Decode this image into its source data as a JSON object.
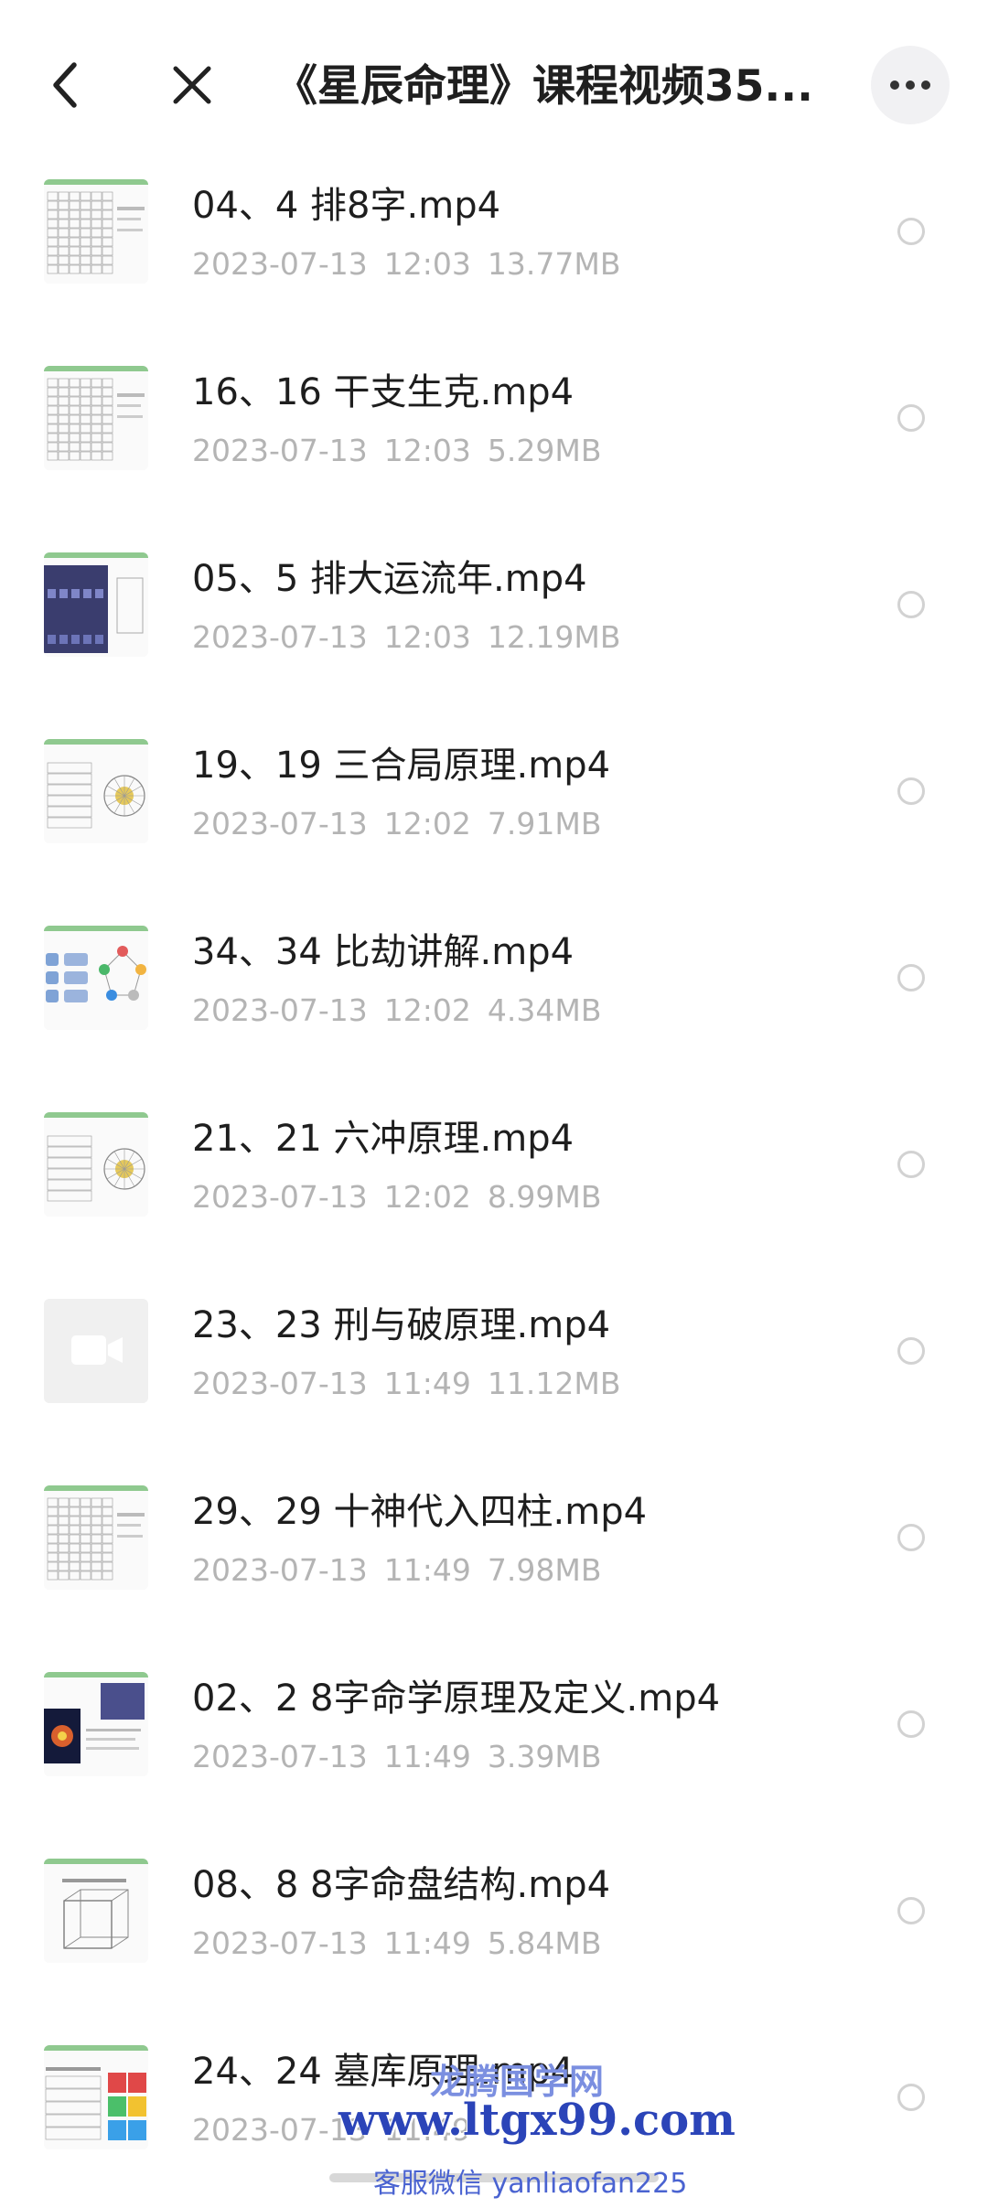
{
  "header": {
    "title": "《星辰命理》课程视频35...",
    "back_icon": "chevron-left-icon",
    "close_icon": "close-icon",
    "more_icon": "more-horizontal-icon"
  },
  "files": [
    {
      "name": "04、4 排8字.mp4",
      "date": "2023-07-13",
      "time": "12:03",
      "size": "13.77MB",
      "thumb": "table"
    },
    {
      "name": "16、16 干支生克.mp4",
      "date": "2023-07-13",
      "time": "12:03",
      "size": "5.29MB",
      "thumb": "table"
    },
    {
      "name": "05、5 排大运流年.mp4",
      "date": "2023-07-13",
      "time": "12:03",
      "size": "12.19MB",
      "thumb": "dark"
    },
    {
      "name": "19、19 三合局原理.mp4",
      "date": "2023-07-13",
      "time": "12:02",
      "size": "7.91MB",
      "thumb": "wheel"
    },
    {
      "name": "34、34 比劫讲解.mp4",
      "date": "2023-07-13",
      "time": "12:02",
      "size": "4.34MB",
      "thumb": "diagram"
    },
    {
      "name": "21、21 六冲原理.mp4",
      "date": "2023-07-13",
      "time": "12:02",
      "size": "8.99MB",
      "thumb": "wheel"
    },
    {
      "name": "23、23 刑与破原理.mp4",
      "date": "2023-07-13",
      "time": "11:49",
      "size": "11.12MB",
      "thumb": "video"
    },
    {
      "name": "29、29 十神代入四柱.mp4",
      "date": "2023-07-13",
      "time": "11:49",
      "size": "7.98MB",
      "thumb": "table"
    },
    {
      "name": "02、2 8字命学原理及定义.mp4",
      "date": "2023-07-13",
      "time": "11:49",
      "size": "3.39MB",
      "thumb": "space"
    },
    {
      "name": "08、8 8字命盘结构.mp4",
      "date": "2023-07-13",
      "time": "11:49",
      "size": "5.84MB",
      "thumb": "cube"
    },
    {
      "name": "24、24 墓库原理.mp4",
      "date": "2023-07-13",
      "time": "11:49",
      "size": "",
      "thumb": "color"
    }
  ],
  "watermark": {
    "line1": "龙腾国学网",
    "line2": "www.ltgx99.com",
    "line3": "客服微信 yanliaofan225"
  },
  "colors": {
    "title": "#1f1f1f",
    "meta": "#b4b4b4",
    "radio_border": "#d2d2d2",
    "watermark_blue": "#2b44b8"
  }
}
